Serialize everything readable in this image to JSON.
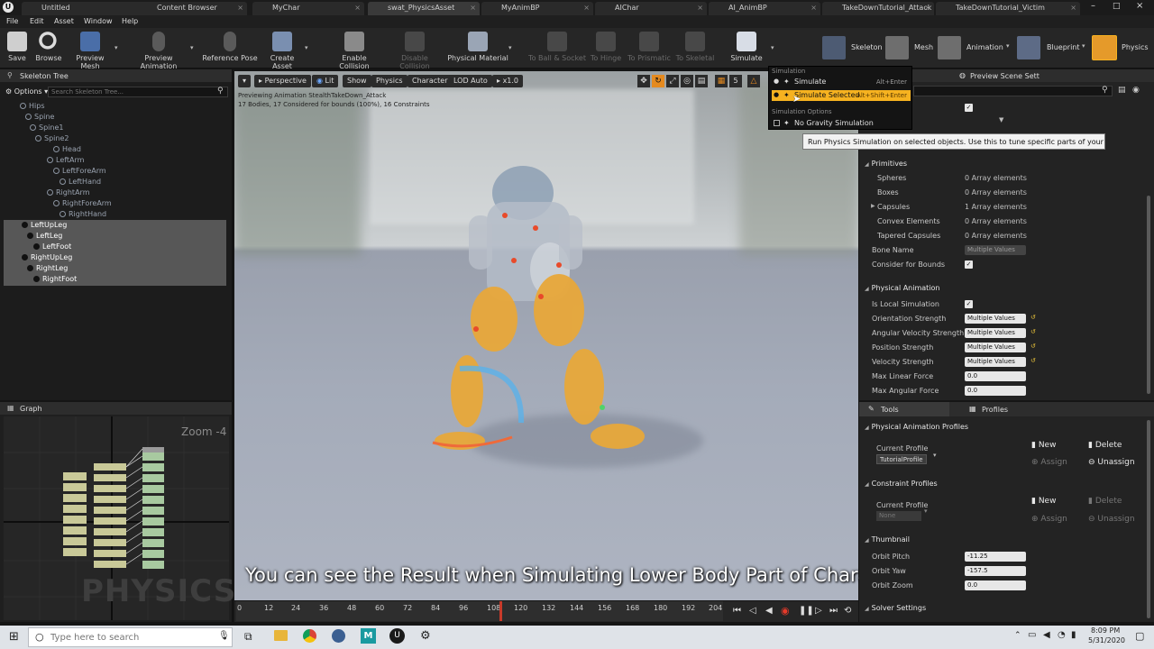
{
  "app": {
    "title_tabs": [
      {
        "label": "Untitled",
        "active": false
      },
      {
        "label": "Content Browser",
        "active": false
      },
      {
        "label": "MyChar",
        "active": false
      },
      {
        "label": "swat_PhysicsAsset",
        "active": true
      },
      {
        "label": "MyAnimBP",
        "active": false
      },
      {
        "label": "AIChar",
        "active": false
      },
      {
        "label": "AI_AnimBP",
        "active": false
      },
      {
        "label": "TakeDownTutorial_Attack",
        "active": false
      },
      {
        "label": "TakeDownTutorial_Victim",
        "active": false
      }
    ],
    "menu": [
      "File",
      "Edit",
      "Asset",
      "Window",
      "Help"
    ]
  },
  "toolbar": {
    "tools": [
      {
        "label": "Save",
        "enabled": true
      },
      {
        "label": "Browse",
        "enabled": true
      },
      {
        "label": "Preview Mesh",
        "enabled": true
      },
      {
        "label": "Preview Animation",
        "enabled": true
      },
      {
        "label": "Reference Pose",
        "enabled": true
      },
      {
        "label": "Create Asset",
        "enabled": true
      },
      {
        "label": "Enable Collision",
        "enabled": true
      },
      {
        "label": "Disable Collision",
        "enabled": false
      },
      {
        "label": "Physical Material",
        "enabled": true
      },
      {
        "label": "To Ball & Socket",
        "enabled": false
      },
      {
        "label": "To Hinge",
        "enabled": false
      },
      {
        "label": "To Prismatic",
        "enabled": false
      },
      {
        "label": "To Skeletal",
        "enabled": false
      },
      {
        "label": "Simulate",
        "enabled": true
      }
    ],
    "modes": [
      "Skeleton",
      "Mesh",
      "Animation",
      "Blueprint",
      "Physics"
    ]
  },
  "skeleton_tree": {
    "title": "Skeleton Tree",
    "options_label": "Options",
    "search_placeholder": "Search Skeleton Tree...",
    "bones": [
      {
        "name": "Hips",
        "selected": false
      },
      {
        "name": "Spine",
        "selected": false
      },
      {
        "name": "Spine1",
        "selected": false
      },
      {
        "name": "Spine2",
        "selected": false
      },
      {
        "name": "Head",
        "selected": false
      },
      {
        "name": "LeftArm",
        "selected": false
      },
      {
        "name": "LeftForeArm",
        "selected": false
      },
      {
        "name": "LeftHand",
        "selected": false
      },
      {
        "name": "RightArm",
        "selected": false
      },
      {
        "name": "RightForeArm",
        "selected": false
      },
      {
        "name": "RightHand",
        "selected": false
      },
      {
        "name": "LeftUpLeg",
        "selected": true
      },
      {
        "name": "LeftLeg",
        "selected": true
      },
      {
        "name": "LeftFoot",
        "selected": true
      },
      {
        "name": "RightUpLeg",
        "selected": true
      },
      {
        "name": "RightLeg",
        "selected": true
      },
      {
        "name": "RightFoot",
        "selected": true
      }
    ]
  },
  "graph": {
    "title": "Graph",
    "zoom": "Zoom -4",
    "watermark": "PHYSICS"
  },
  "viewport": {
    "buttons": [
      "Perspective",
      "Lit",
      "Show",
      "Physics",
      "Character",
      "LOD Auto",
      "x1.0"
    ],
    "info_line1": "Previewing Animation StealthTakeDown_Attack",
    "info_line2": "17 Bodies, 17 Considered for bounds (100%), 16 Constraints",
    "grid_num": "5"
  },
  "dropdown": {
    "section1": "Simulation",
    "item1": "Simulate",
    "item1_shortcut": "Alt+Enter",
    "item2": "Simulate Selected",
    "item2_shortcut": "Alt+Shift+Enter",
    "section2": "Simulation Options",
    "item3": "No Gravity Simulation"
  },
  "tooltip": "Run Physics Simulation on selected objects. Use this to tune  specific parts of your ragdoll.",
  "details": {
    "preview_tab": "Preview Scene Sett",
    "primitives_title": "Primitives",
    "primitives": [
      {
        "label": "Spheres",
        "value": "0 Array elements"
      },
      {
        "label": "Boxes",
        "value": "0 Array elements"
      },
      {
        "label": "Capsules",
        "value": "1 Array elements"
      },
      {
        "label": "Convex Elements",
        "value": "0 Array elements"
      },
      {
        "label": "Tapered Capsules",
        "value": "0 Array elements"
      }
    ],
    "bone_name_label": "Bone Name",
    "bone_name_value": "Multiple Values",
    "consider_bounds_label": "Consider for Bounds",
    "phys_anim_title": "Physical Animation",
    "is_local_label": "Is Local Simulation",
    "phys_rows": [
      {
        "label": "Orientation Strength",
        "value": "Multiple Values"
      },
      {
        "label": "Angular Velocity Strength",
        "value": "Multiple Values"
      },
      {
        "label": "Position Strength",
        "value": "Multiple Values"
      },
      {
        "label": "Velocity Strength",
        "value": "Multiple Values"
      },
      {
        "label": "Max Linear Force",
        "value": "0.0"
      },
      {
        "label": "Max Angular Force",
        "value": "0.0"
      }
    ]
  },
  "profiles_panel": {
    "tab_tools": "Tools",
    "tab_profiles": "Profiles",
    "pap_title": "Physical Animation Profiles",
    "current_profile_label": "Current Profile",
    "current_profile_value": "TutorialProfile",
    "new": "New",
    "delete": "Delete",
    "assign": "Assign",
    "unassign": "Unassign",
    "cp_title": "Constraint Profiles",
    "cp_current_label": "Current Profile",
    "cp_current_value": "None",
    "thumb_title": "Thumbnail",
    "orbit_pitch_label": "Orbit Pitch",
    "orbit_pitch_value": "-11.25",
    "orbit_yaw_label": "Orbit Yaw",
    "orbit_yaw_value": "-157.5",
    "orbit_zoom_label": "Orbit Zoom",
    "orbit_zoom_value": "0.0",
    "solver_title": "Solver Settings"
  },
  "timeline": {
    "ticks": [
      "0",
      "12",
      "24",
      "36",
      "48",
      "60",
      "72",
      "84",
      "96",
      "108",
      "120",
      "132",
      "144",
      "156",
      "168",
      "180",
      "192",
      "204"
    ]
  },
  "subtitle": "You can see the Result when Simulating Lower Body Part of Character",
  "taskbar": {
    "search_placeholder": "Type here to search",
    "time": "8:09 PM",
    "date": "5/31/2020"
  },
  "colors": {
    "highlight": "#f6b220",
    "selected_body": "#e8a83a",
    "accent_blue": "#2f7de0"
  }
}
